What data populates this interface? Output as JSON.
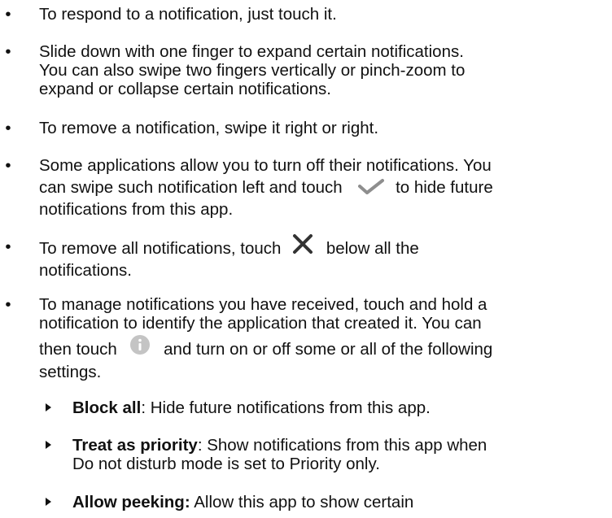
{
  "bullets": [
    {
      "lines": [
        "To respond to a notification, just touch it."
      ]
    },
    {
      "lines": [
        "Slide down with one finger to expand certain notifications.",
        "You can also swipe two fingers vertically or pinch-zoom to",
        "expand or collapse certain notifications."
      ]
    },
    {
      "lines": [
        "To remove a notification, swipe it right or right."
      ]
    },
    {
      "line1": "Some applications allow you to turn off their notifications. You",
      "line2_before": "can swipe such notification left and touch",
      "line2_after": "to hide future",
      "line3": "notifications from this app.",
      "icon": "checkmark-icon"
    },
    {
      "line1_before": "To remove all notifications, touch",
      "line1_after": "below all the",
      "line2": "notifications.",
      "icon": "close-x-icon"
    },
    {
      "line1": "To manage notifications you have received, touch and hold a",
      "line2": "notification to identify the application that created it. You can",
      "line3_before": "then touch",
      "line3_after": "and turn on or off some or all of the following",
      "line4": "settings.",
      "icon": "info-icon"
    }
  ],
  "sub_items": [
    {
      "term": "Block all",
      "desc_lines": [
        ": Hide future notifications from this app."
      ]
    },
    {
      "term": "Treat as priority",
      "desc_lines": [
        ": Show notifications from this app when",
        "Do not disturb mode is set to Priority only."
      ]
    },
    {
      "term": "Allow peeking:",
      "desc_lines": [
        " Allow this app to show certain"
      ]
    }
  ],
  "colors": {
    "text": "#111111",
    "checkmark": "#8e8e8e",
    "info": "#c4c4c4",
    "x": "#333333"
  }
}
